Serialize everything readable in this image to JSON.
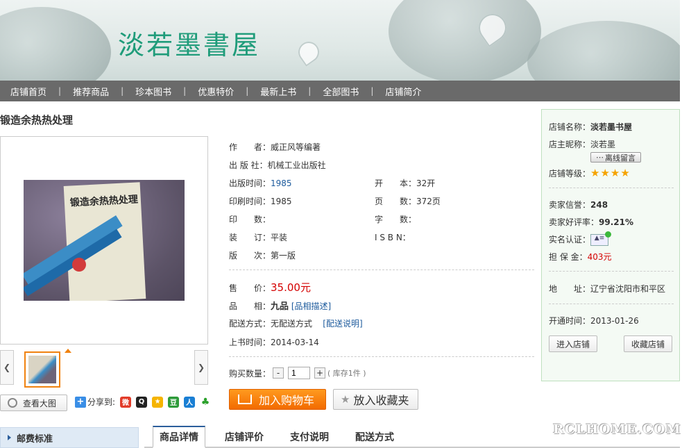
{
  "banner": {
    "shop_logo": "淡若墨書屋"
  },
  "nav": {
    "items": [
      "店铺首页",
      "推荐商品",
      "珍本图书",
      "优惠特价",
      "最新上书",
      "全部图书",
      "店铺简介"
    ]
  },
  "product": {
    "title": "锻造余热热处理",
    "cover_title": "锻造余热热处理",
    "view_large_label": "查看大图",
    "share_label": "分享到:",
    "share_icons": [
      "weibo-icon",
      "qq-icon",
      "qzone-icon",
      "douban-icon",
      "renren-icon",
      "kaixin-icon"
    ],
    "info": {
      "author_label": "作　　者：",
      "author": "威正风等编著",
      "publisher_label": "出 版 社：",
      "publisher": "机械工业出版社",
      "pub_date_label": "出版时间：",
      "pub_date": "1985",
      "format_label": "开　　本：",
      "format": "32开",
      "print_date_label": "印刷时间：",
      "print_date": "1985",
      "pages_label": "页　　数：",
      "pages": "372页",
      "print_count_label": "印　　数：",
      "print_count": "",
      "word_count_label": "字　　数：",
      "word_count": "",
      "binding_label": "装　　订：",
      "binding": "平装",
      "isbn_label": "I S B N：",
      "isbn": "",
      "edition_label": "版　　次：",
      "edition": "第一版",
      "price_label": "售　　价：",
      "price": "35.00元",
      "condition_label": "品　　相：",
      "condition": "九品",
      "condition_link": "[品相描述]",
      "shipping_label": "配送方式：",
      "shipping": "无配送方式",
      "shipping_link": "[配送说明]",
      "listed_label": "上书时间：",
      "listed": "2014-03-14"
    },
    "quantity_label": "购买数量：",
    "quantity_value": "1",
    "stock_text": "( 库存1件 )",
    "add_cart_label": "加入购物车",
    "add_fav_label": "放入收藏夹"
  },
  "shop": {
    "name_label": "店铺名称：",
    "name": "淡若墨书屋",
    "owner_label": "店主昵称：",
    "owner": "淡若墨",
    "message_button": "离线留言",
    "level_label": "店铺等级：",
    "level_stars": 4,
    "credit_label": "卖家信誉：",
    "credit": "248",
    "rating_label": "卖家好评率：",
    "rating": "99.21%",
    "verify_label": "实名认证：",
    "deposit_label": "担 保 金：",
    "deposit": "403元",
    "address_label": "地　　址：",
    "address": "辽宁省沈阳市和平区",
    "opened_label": "开通时间：",
    "opened": "2013-01-26",
    "enter_button": "进入店铺",
    "fav_button": "收藏店铺"
  },
  "bottom": {
    "postage": "邮费标准",
    "tabs": [
      "商品详情",
      "店铺评价",
      "支付说明",
      "配送方式"
    ],
    "watermark": "RCLHOME.COM"
  },
  "colors": {
    "nav_bg": "#6a6a6a",
    "price_red": "#d40000",
    "cart_orange": "#f26b00",
    "link_blue": "#1c5a9c",
    "logo_green": "#1f9c7a"
  }
}
